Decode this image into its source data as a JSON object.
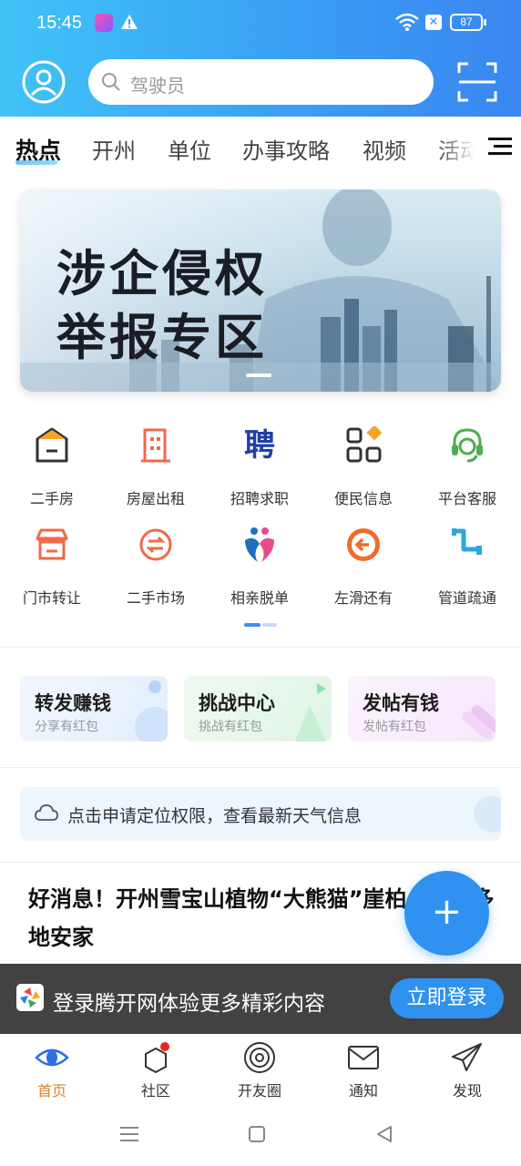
{
  "status": {
    "time": "15:45",
    "battery": "87"
  },
  "search": {
    "placeholder": "驾驶员"
  },
  "tabs": [
    "热点",
    "开州",
    "单位",
    "办事攻略",
    "视频",
    "活动"
  ],
  "banner": {
    "line1": "涉企侵权",
    "line2": "举报专区"
  },
  "grid": [
    {
      "label": "二手房",
      "icon": "house-icon"
    },
    {
      "label": "房屋出租",
      "icon": "building-icon"
    },
    {
      "label": "招聘求职",
      "icon": "recruit-icon",
      "glyph": "聘"
    },
    {
      "label": "便民信息",
      "icon": "apps-icon"
    },
    {
      "label": "平台客服",
      "icon": "headset-icon"
    },
    {
      "label": "门市转让",
      "icon": "shop-icon"
    },
    {
      "label": "二手市场",
      "icon": "exchange-icon"
    },
    {
      "label": "相亲脱单",
      "icon": "dating-icon"
    },
    {
      "label": "左滑还有",
      "icon": "arrow-left-icon"
    },
    {
      "label": "管道疏通",
      "icon": "pipe-icon"
    }
  ],
  "cards": [
    {
      "title": "转发赚钱",
      "sub": "分享有红包"
    },
    {
      "title": "挑战中心",
      "sub": "挑战有红包"
    },
    {
      "title": "发帖有钱",
      "sub": "发帖有红包"
    }
  ],
  "weather": {
    "text": "点击申请定位权限，查看最新天气信息"
  },
  "news": {
    "title": "好消息！开州雪宝山植物“大熊猫”崖柏……国多地安家"
  },
  "fab": {
    "label": "+"
  },
  "login": {
    "text": "登录腾开网体验更多精彩内容",
    "button": "立即登录"
  },
  "nav": [
    {
      "label": "首页",
      "icon": "eye-icon",
      "active": true
    },
    {
      "label": "社区",
      "icon": "community-icon"
    },
    {
      "label": "开友圈",
      "icon": "circle-icon"
    },
    {
      "label": "通知",
      "icon": "mail-icon"
    },
    {
      "label": "发现",
      "icon": "paper-plane-icon"
    }
  ],
  "colors": {
    "accent": "#2f92f0",
    "active_nav": "#d9822b",
    "header_start": "#40c3f7",
    "header_end": "#3a86f1"
  }
}
